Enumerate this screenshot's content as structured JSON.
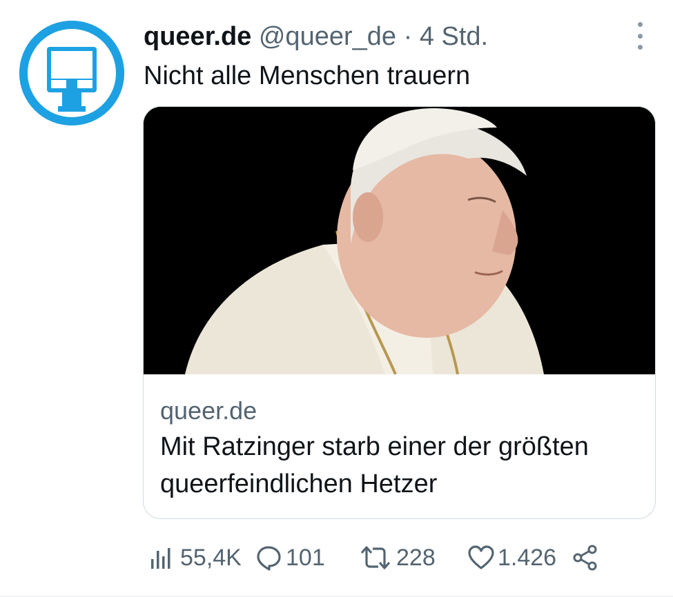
{
  "author": {
    "name": "queer.de",
    "handle": "@queer_de",
    "separator": "·",
    "time": "4 Std.",
    "avatar_icon": "queer-de-logo-icon",
    "avatar_color": "#1da1e2"
  },
  "tweet": {
    "text": "Nicht alle Menschen trauern"
  },
  "card": {
    "image_icon": "photo-elderly-man-in-white-cassock",
    "domain": "queer.de",
    "title": "Mit Ratzinger starb einer der größten queerfeindlichen Hetzer"
  },
  "actions": {
    "views": {
      "icon": "analytics-icon",
      "count": "55,4K"
    },
    "replies": {
      "icon": "reply-icon",
      "count": "101"
    },
    "retweets": {
      "icon": "retweet-icon",
      "count": "228"
    },
    "likes": {
      "icon": "heart-icon",
      "count": "1.426"
    },
    "share": {
      "icon": "share-icon"
    }
  },
  "colors": {
    "text_primary": "#0f1419",
    "text_secondary": "#536471",
    "border": "#cfd9de"
  }
}
